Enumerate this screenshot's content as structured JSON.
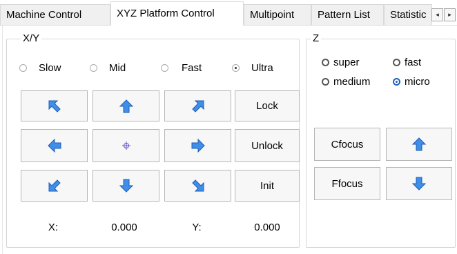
{
  "tabs": [
    {
      "label": "Machine Control",
      "active": false
    },
    {
      "label": "XYZ Platform Control",
      "active": true
    },
    {
      "label": "Multipoint",
      "active": false
    },
    {
      "label": "Pattern List",
      "active": false
    },
    {
      "label": "Statistic",
      "active": false
    }
  ],
  "tab_scroll": {
    "left_glyph": "◂",
    "right_glyph": "▸"
  },
  "xy": {
    "title": "X/Y",
    "speeds": [
      {
        "label": "Slow",
        "selected": false
      },
      {
        "label": "Mid",
        "selected": false
      },
      {
        "label": "Fast",
        "selected": false
      },
      {
        "label": "Ultra",
        "selected": true
      }
    ],
    "buttons": {
      "lock": "Lock",
      "unlock": "Unlock",
      "init": "Init"
    },
    "direction_icons": [
      "arrow-up-left-icon",
      "arrow-up-icon",
      "arrow-up-right-icon",
      "arrow-left-icon",
      "crosshair-icon",
      "arrow-right-icon",
      "arrow-down-left-icon",
      "arrow-down-icon",
      "arrow-down-right-icon"
    ],
    "x_label": "X:",
    "x_value": "0.000",
    "y_label": "Y:",
    "y_value": "0.000"
  },
  "z": {
    "title": "Z",
    "speeds": [
      {
        "label": "super",
        "selected": false
      },
      {
        "label": "fast",
        "selected": false
      },
      {
        "label": "medium",
        "selected": false
      },
      {
        "label": "micro",
        "selected": true
      }
    ],
    "buttons": {
      "cfocus": "Cfocus",
      "ffocus": "Ffocus"
    }
  },
  "colors": {
    "arrow_fill": "#3f8ee8",
    "arrow_shade": "#1d5cb8",
    "crosshair": "#6a4fc4",
    "selected_radio": "#1f5fbf"
  }
}
